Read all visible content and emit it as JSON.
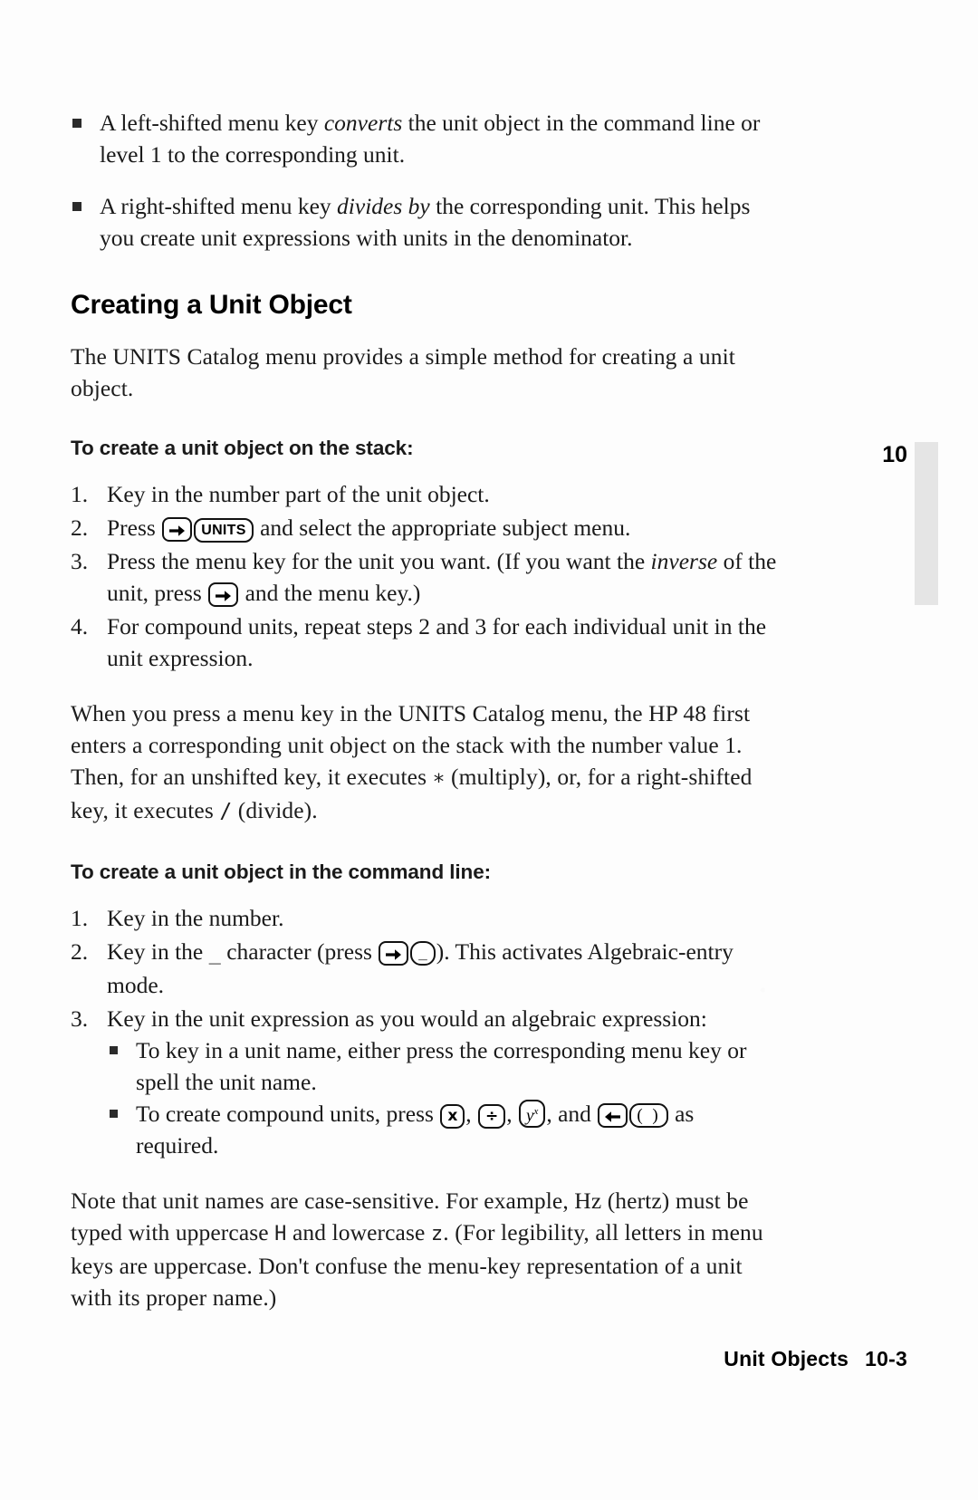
{
  "document": {
    "page_label": "10-3",
    "chapter_tab": "10",
    "footer_title": "Unit Objects",
    "footer_page": "10-3"
  },
  "intro_bullets": [
    {
      "text_before": "A left-shifted menu key ",
      "italic": "converts",
      "text_after": " the unit object in the command line or level 1 to the corresponding unit."
    },
    {
      "text_before": "A right-shifted menu key ",
      "italic": "divides by",
      "text_after": " the corresponding unit. This helps you create unit expressions with units in the denominator."
    }
  ],
  "section": {
    "heading": "Creating a Unit Object",
    "intro_paragraph": "The UNITS Catalog menu provides a simple method for creating a unit object."
  },
  "stack_procedure": {
    "heading": "To create a unit object on the stack:",
    "steps": [
      {
        "number": "1.",
        "part1": "Key in the number part of the unit object."
      },
      {
        "number": "2.",
        "part1": "Press ",
        "key1": "right-shift-icon",
        "key2_label": "UNITS",
        "part2": " and select the appropriate subject menu."
      },
      {
        "number": "3.",
        "part1": "Press the menu key for the unit you want. (If you want the ",
        "italic1": "inverse",
        "part2": " of the unit, press ",
        "key1": "right-shift-icon",
        "part3": " and the menu key.)"
      },
      {
        "number": "4.",
        "part1": "For compound units, repeat steps 2 and 3 for each individual unit in the unit expression."
      }
    ]
  },
  "explanation_paragraph": {
    "part1": "When you press a menu key in the UNITS Catalog menu, the HP 48 first enters a corresponding unit object on the stack with the number value 1. Then, for an unshifted key, it executes ",
    "multiply_symbol": "∗",
    "part2": " (multiply), or, for a right-shifted key, it executes ",
    "divide_symbol": "/",
    "part3": " (divide)."
  },
  "commandline_procedure": {
    "heading": "To create a unit object in the command line:",
    "steps": [
      {
        "number": "1.",
        "part1": "Key in the number."
      },
      {
        "number": "2.",
        "part1": "Key in the ",
        "underscore_char": "_",
        "part2": " character (press ",
        "key1": "right-shift-icon",
        "key2_label": "_",
        "part3": "). This activates Algebraic-entry mode."
      },
      {
        "number": "3.",
        "part1": "Key in the unit expression as you would an algebraic expression:",
        "sub_bullets": [
          {
            "text": "To key in a unit name, either press the corresponding menu key or spell the unit name."
          },
          {
            "part1": "To create compound units, press ",
            "key_multiply": "x",
            "sep1": ", ",
            "key_divide": "÷",
            "sep2": ", ",
            "key_power": "y",
            "key_power_exp": "x",
            "sep3": ", and ",
            "key_leftshift": "left-shift-icon",
            "key_parens": "( )",
            "part2": " as required."
          }
        ]
      }
    ]
  },
  "note_paragraph": {
    "part1": "Note that unit names are case-sensitive. For example, Hz (hertz) must be typed with uppercase ",
    "calc_upper": "H",
    "part2": " and lowercase ",
    "calc_lower": "z",
    "part3": ". (For legibility, all letters in menu keys are uppercase. Don't confuse the menu-key representation of a unit with its proper name.)"
  }
}
